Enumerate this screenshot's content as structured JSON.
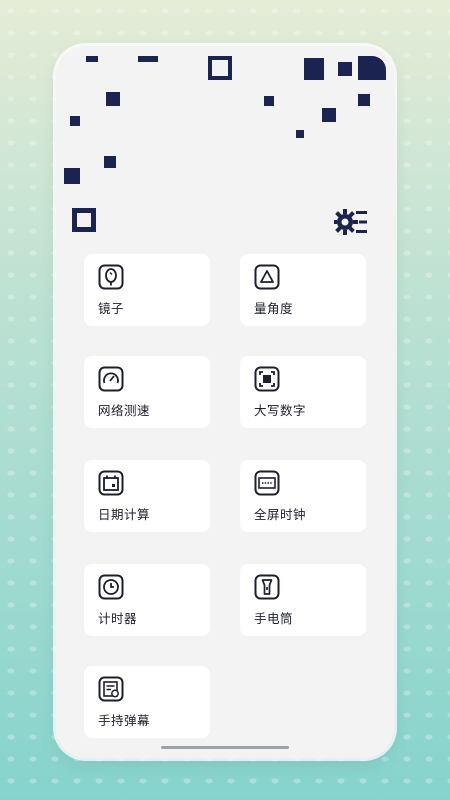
{
  "theme": {
    "accent": "#1b2350",
    "card_bg": "#ffffff",
    "screen_bg": "#f3f3f3"
  },
  "header": {
    "settings_icon": "gear-list-icon",
    "brand_icon": "square-logo-icon"
  },
  "tools": [
    {
      "label": "镜子",
      "icon": "mirror-icon"
    },
    {
      "label": "量角度",
      "icon": "angle-icon"
    },
    {
      "label": "网络测速",
      "icon": "speedometer-icon"
    },
    {
      "label": "大写数字",
      "icon": "scan-text-icon"
    },
    {
      "label": "日期计算",
      "icon": "calendar-icon"
    },
    {
      "label": "全屏时钟",
      "icon": "fullscreen-clock-icon"
    },
    {
      "label": "计时器",
      "icon": "timer-icon"
    },
    {
      "label": "手电筒",
      "icon": "flashlight-icon"
    },
    {
      "label": "手持弹幕",
      "icon": "barrage-icon"
    }
  ]
}
